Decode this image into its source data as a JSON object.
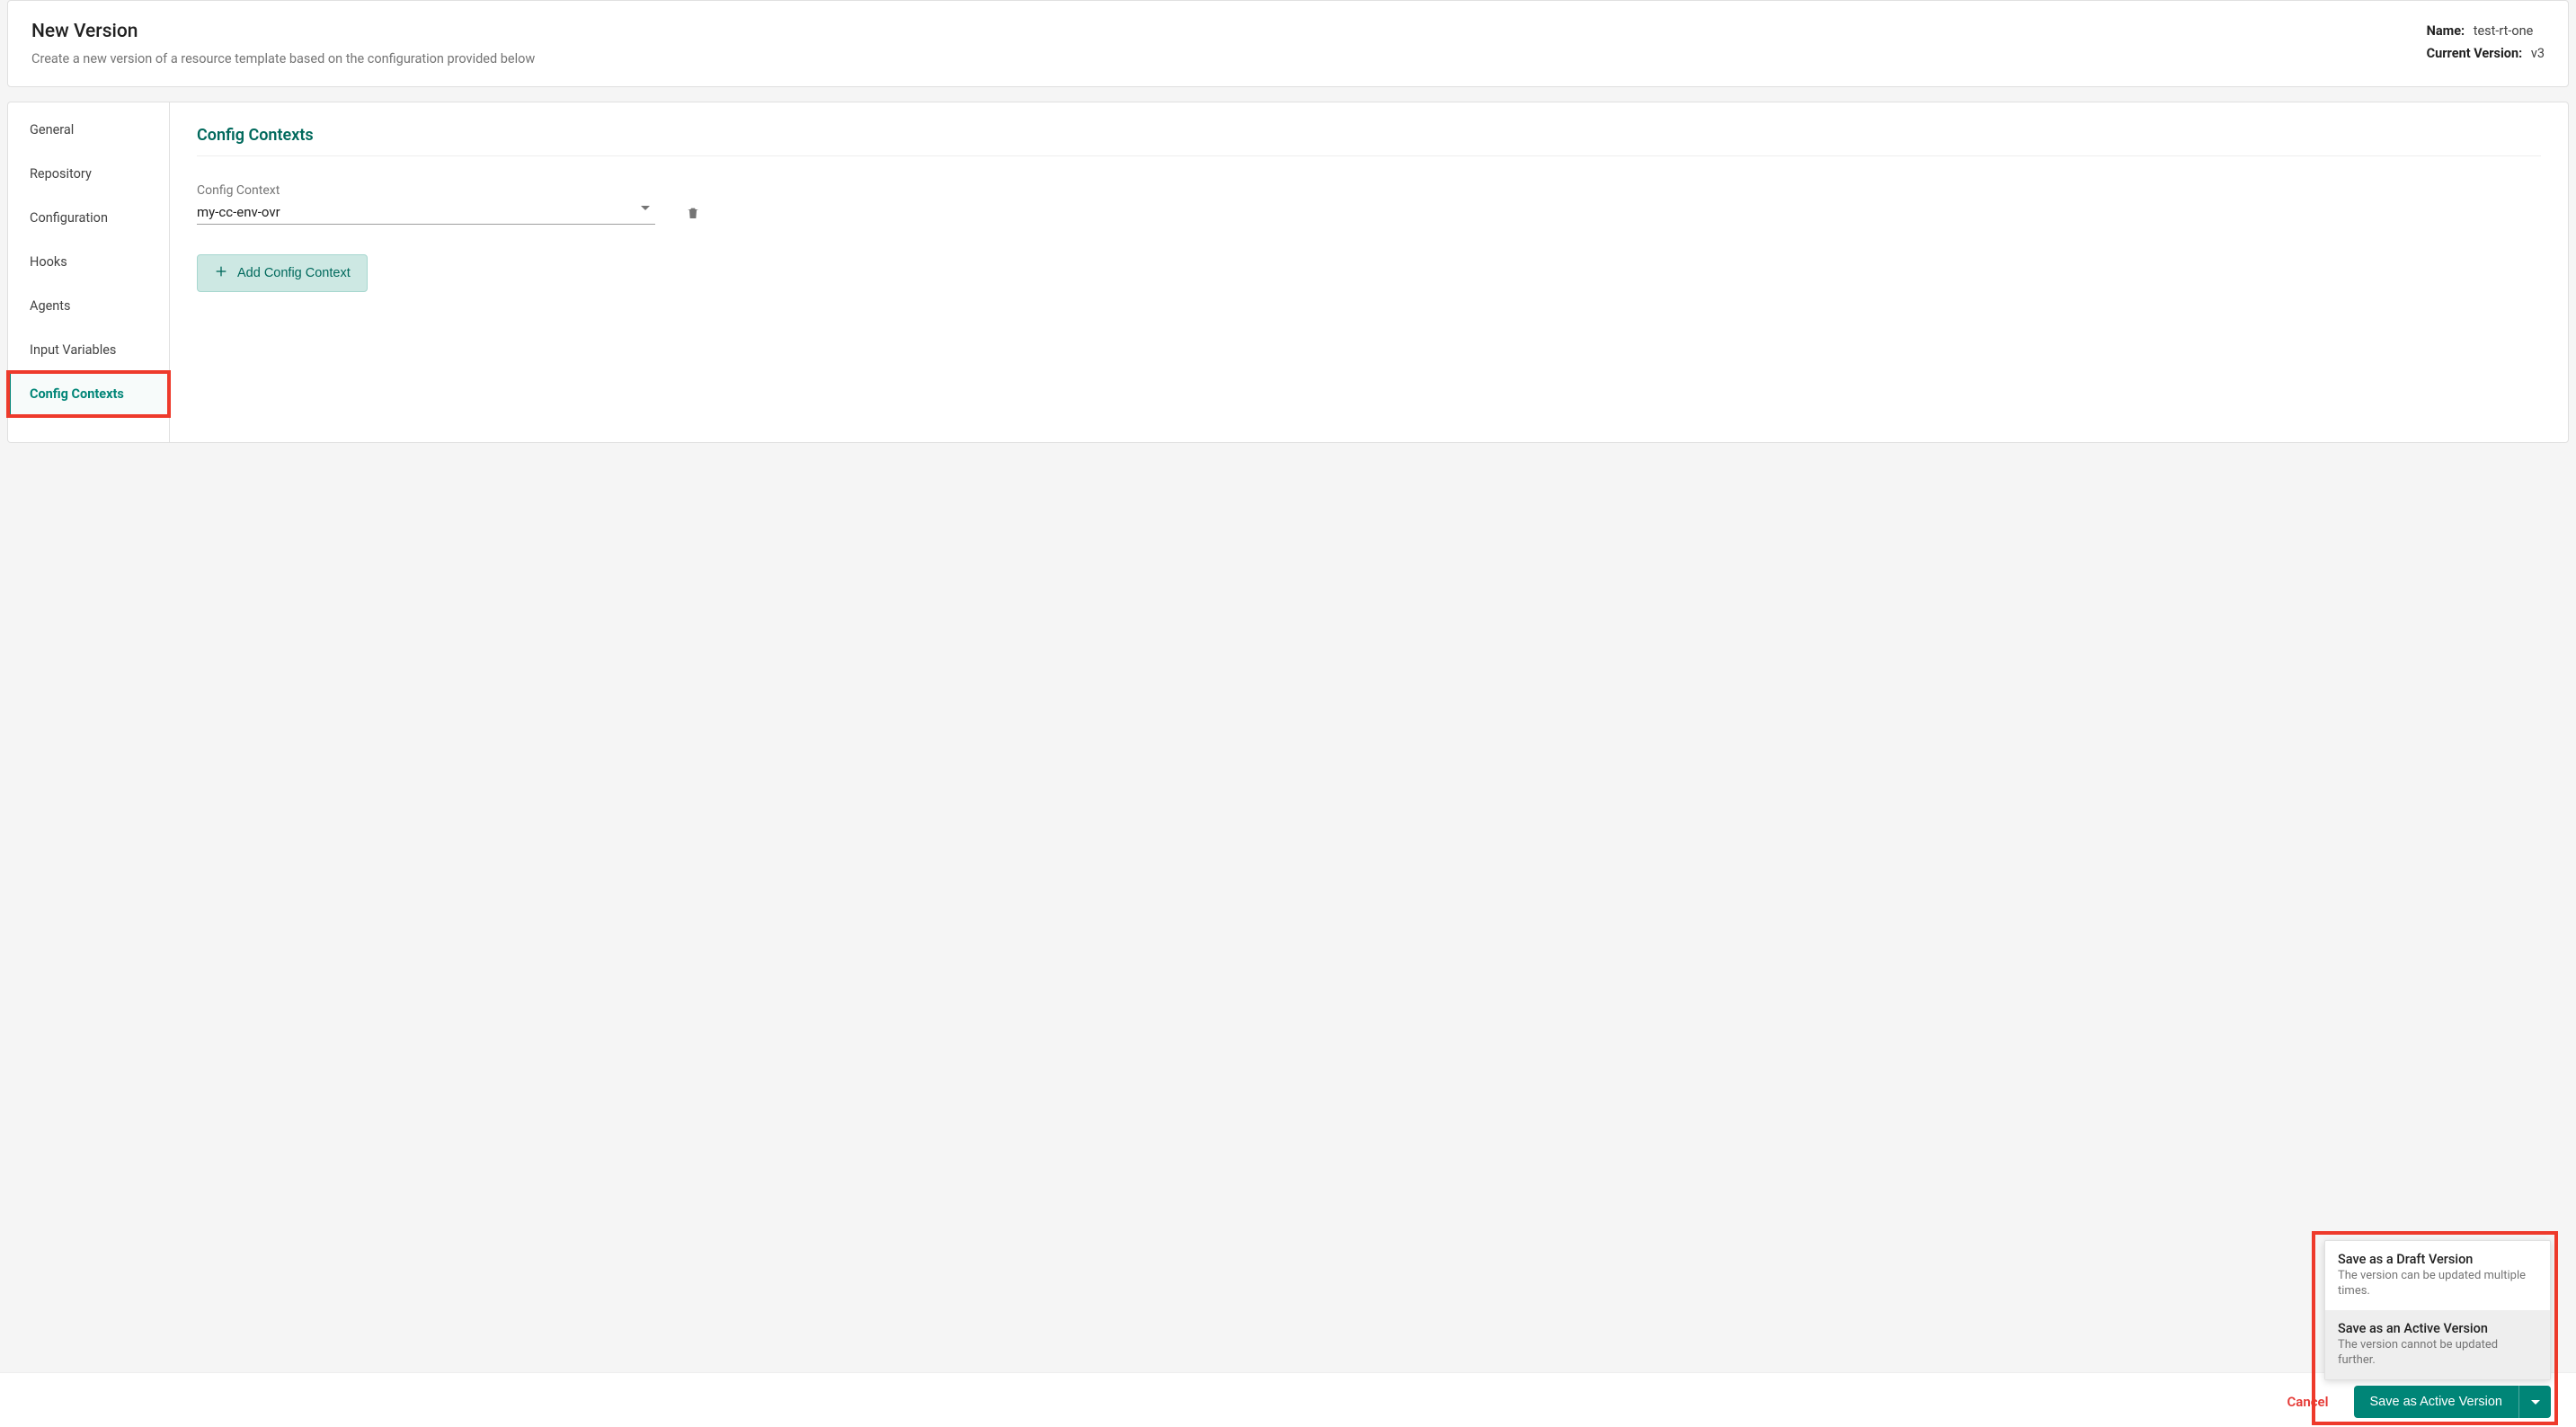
{
  "header": {
    "title": "New Version",
    "subtitle": "Create a new version of a resource template based on the configuration provided below",
    "name_label": "Name:",
    "name_value": "test-rt-one",
    "version_label": "Current Version:",
    "version_value": "v3"
  },
  "sidebar": {
    "items": [
      {
        "label": "General"
      },
      {
        "label": "Repository"
      },
      {
        "label": "Configuration"
      },
      {
        "label": "Hooks"
      },
      {
        "label": "Agents"
      },
      {
        "label": "Input Variables"
      },
      {
        "label": "Config Contexts"
      }
    ]
  },
  "content": {
    "heading": "Config Contexts",
    "field_label": "Config Context",
    "selected_value": "my-cc-env-ovr",
    "add_button_label": "Add Config Context"
  },
  "footer": {
    "cancel_label": "Cancel",
    "save_button_label": "Save as Active Version",
    "options": [
      {
        "title": "Save as a Draft Version",
        "desc": "The version can be updated multiple times."
      },
      {
        "title": "Save as an Active Version",
        "desc": "The version cannot be updated further."
      }
    ]
  },
  "colors": {
    "accent": "#008577",
    "accent_dark": "#00695c",
    "highlight": "#ee3a2b",
    "danger": "#e53935"
  }
}
